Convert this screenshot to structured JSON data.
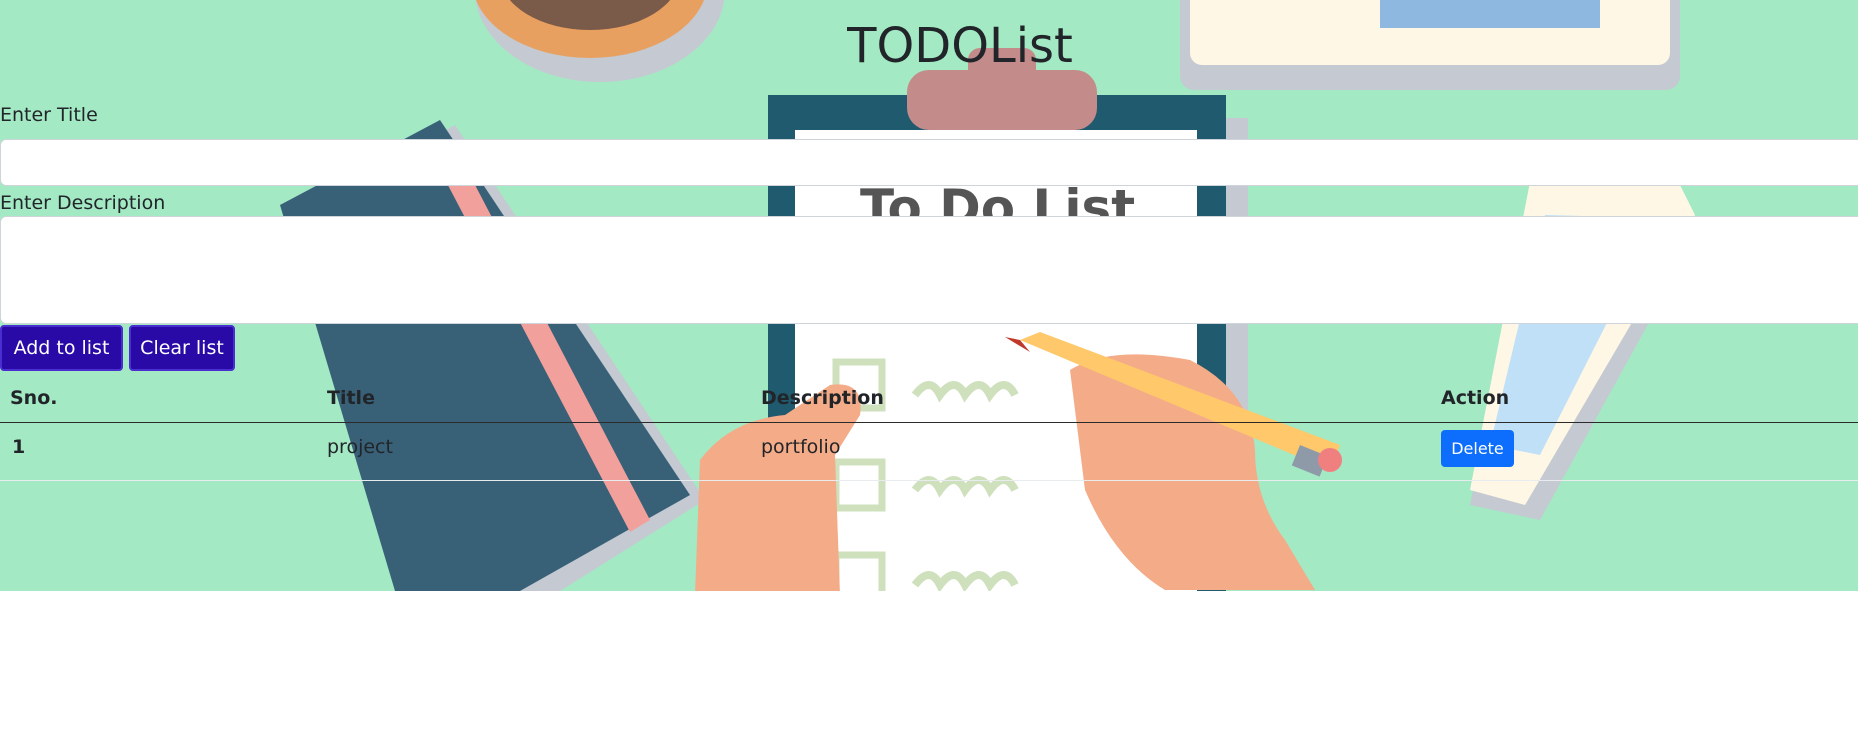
{
  "app": {
    "title": "TODOList"
  },
  "form": {
    "title_label": "Enter Title",
    "title_value": "",
    "description_label": "Enter Description",
    "description_value": "",
    "add_button": "Add to list",
    "clear_button": "Clear list"
  },
  "table": {
    "headers": [
      "Sno.",
      "Title",
      "Description",
      "Action"
    ],
    "rows": [
      {
        "sno": "1",
        "title": "project",
        "description": "portfolio",
        "action": "Delete"
      }
    ]
  },
  "colors": {
    "hero_background": "#a3e9c4",
    "button_primary": "#2a0aa6",
    "delete_button": "#0d6efd"
  }
}
